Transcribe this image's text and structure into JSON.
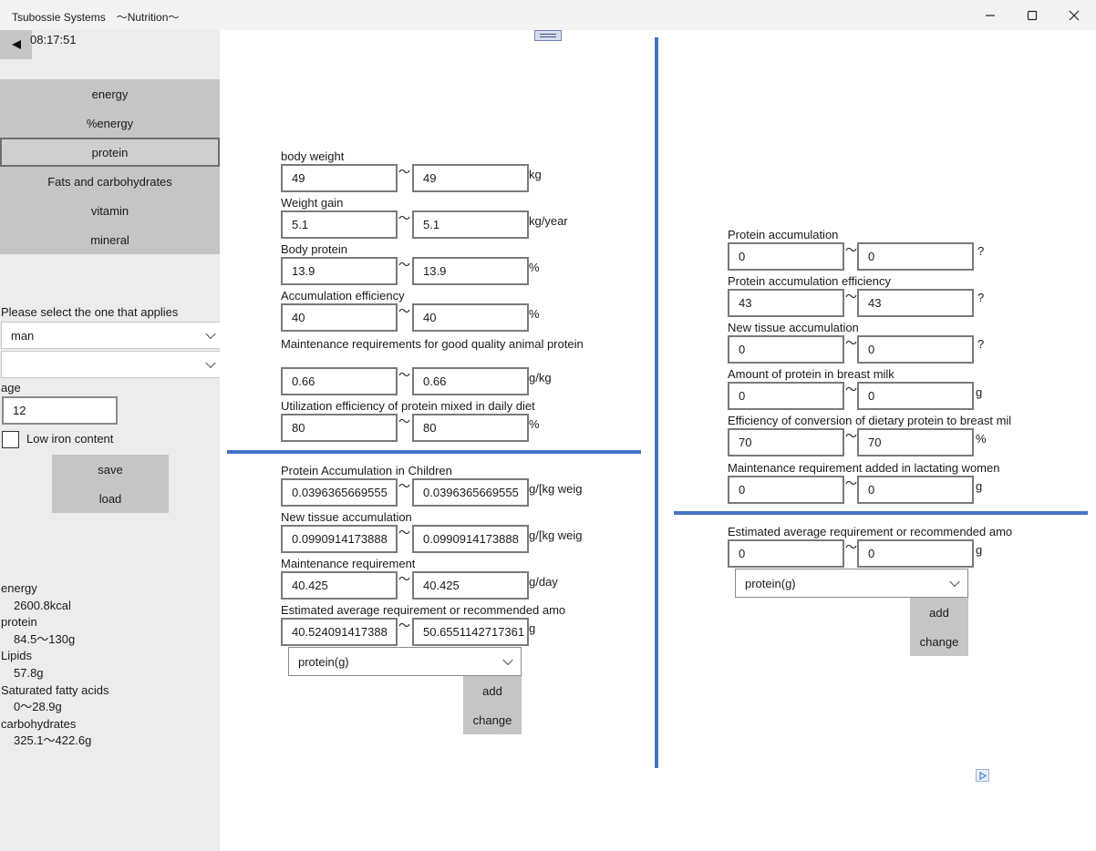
{
  "window": {
    "title": "Tsubossie Systems　～Nutrition～",
    "minimize_icon": "minimize-icon",
    "maximize_icon": "maximize-icon",
    "close_icon": "close-icon"
  },
  "sidebar": {
    "time": "08:17:51",
    "nav": [
      {
        "label": "energy"
      },
      {
        "label": "%energy"
      },
      {
        "label": "protein",
        "active": true
      },
      {
        "label": "Fats and carbohydrates"
      },
      {
        "label": "vitamin"
      },
      {
        "label": "mineral"
      }
    ],
    "select_prompt": "Please select the one that applies",
    "sex_value": "man",
    "second_value": "",
    "age_label": "age",
    "age_value": "12",
    "low_iron_label": "Low iron content",
    "low_iron_checked": false,
    "save_label": "save",
    "load_label": "load",
    "summary": [
      {
        "name": "energy",
        "value": "2600.8kcal"
      },
      {
        "name": "protein",
        "value": "84.5～130g"
      },
      {
        "name": "Lipids",
        "value": "57.8g"
      },
      {
        "name": "Saturated fatty acids",
        "value": "0～28.9g"
      },
      {
        "name": "carbohydrates",
        "value": "325.1～422.6g"
      }
    ]
  },
  "left_panel": {
    "top_fields": [
      {
        "label": "body weight",
        "min": "49",
        "max": "49",
        "unit": "kg"
      },
      {
        "label": "Weight gain",
        "min": "5.1",
        "max": "5.1",
        "unit": "kg/year"
      },
      {
        "label": "Body protein",
        "min": "13.9",
        "max": "13.9",
        "unit": "%"
      },
      {
        "label": "Accumulation efficiency",
        "min": "40",
        "max": "40",
        "unit": "%"
      },
      {
        "label": "Maintenance requirements for good quality animal protein",
        "min": "0.66",
        "max": "0.66",
        "unit": "g/kg"
      },
      {
        "label": "Utilization efficiency of protein mixed in daily diet",
        "min": "80",
        "max": "80",
        "unit": "%"
      }
    ],
    "bottom_fields": [
      {
        "label": "Protein Accumulation in Children",
        "min": "0.0396365669555",
        "max": "0.0396365669555",
        "unit": "g/[kg weig"
      },
      {
        "label": "New tissue accumulation",
        "min": "0.0990914173888",
        "max": "0.0990914173888",
        "unit": "g/[kg weig"
      },
      {
        "label": "Maintenance requirement",
        "min": "40.425",
        "max": "40.425",
        "unit": "g/day"
      },
      {
        "label": "Estimated average requirement or recommended amo",
        "min": "40.524091417388",
        "max": "50.6551142717361",
        "unit": "g"
      }
    ],
    "nutrient_select": "protein(g)",
    "add_label": "add",
    "change_label": "change"
  },
  "right_panel": {
    "top_fields": [
      {
        "label": "Protein accumulation",
        "min": "0",
        "max": "0",
        "unit": "?"
      },
      {
        "label": "Protein accumulation efficiency",
        "min": "43",
        "max": "43",
        "unit": "?"
      },
      {
        "label": "New tissue accumulation",
        "min": "0",
        "max": "0",
        "unit": "?"
      },
      {
        "label": "Amount of protein in breast milk",
        "min": "0",
        "max": "0",
        "unit": "g"
      },
      {
        "label": "Efficiency of conversion of dietary protein to breast mil",
        "min": "70",
        "max": "70",
        "unit": "%"
      },
      {
        "label": "Maintenance requirement added in lactating women",
        "min": "0",
        "max": "0",
        "unit": "g"
      }
    ],
    "bottom_fields": [
      {
        "label": "Estimated average requirement or recommended amo",
        "min": "0",
        "max": "0",
        "unit": "g"
      }
    ],
    "nutrient_select": "protein(g)",
    "add_label": "add",
    "change_label": "change"
  },
  "tilde": "～",
  "colors": {
    "separator": "#4472c4",
    "nav_bg": "#c5c5c5",
    "sidebar_bg": "#ececec"
  }
}
